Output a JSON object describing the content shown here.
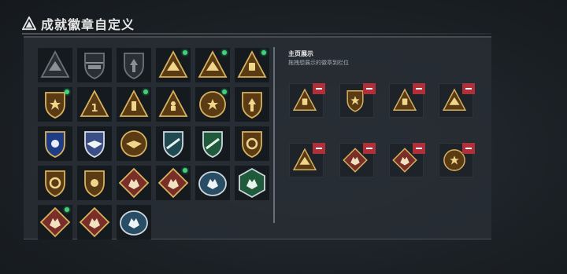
{
  "header": {
    "title": "成就徽章自定义",
    "logo_icon": "triangle-emblem-icon"
  },
  "collection": {
    "badges": [
      {
        "icon": "mountain-triangle-badge-icon",
        "style": "locked",
        "new": false
      },
      {
        "icon": "helicopter-badge-icon",
        "style": "locked",
        "new": false
      },
      {
        "icon": "arrow-shield-badge-icon",
        "style": "locked",
        "new": false
      },
      {
        "icon": "mountain-triangle-badge-icon",
        "style": "gold",
        "new": true
      },
      {
        "icon": "mountain-triangle-badge-icon",
        "style": "gold",
        "new": true
      },
      {
        "icon": "trophy-triangle-badge-icon",
        "style": "gold",
        "new": true
      },
      {
        "icon": "shield-star-badge-icon",
        "style": "gold",
        "new": true
      },
      {
        "icon": "rank-one-triangle-badge-icon",
        "style": "gold",
        "new": false
      },
      {
        "icon": "pillar-triangle-badge-icon",
        "style": "gold",
        "new": true
      },
      {
        "icon": "warrior-triangle-badge-icon",
        "style": "gold",
        "new": false
      },
      {
        "icon": "star-medallion-badge-icon",
        "style": "gold",
        "new": true
      },
      {
        "icon": "arrow-shield-badge-icon",
        "style": "gold",
        "new": false
      },
      {
        "icon": "blue-shield-badge-icon",
        "style": "blue",
        "new": false
      },
      {
        "icon": "eagle-shield-badge-icon",
        "style": "silver",
        "new": false
      },
      {
        "icon": "wings-medallion-badge-icon",
        "style": "gold",
        "new": false
      },
      {
        "icon": "rifle-shield-badge-icon",
        "style": "teal",
        "new": false
      },
      {
        "icon": "rifle-shield-badge-icon",
        "style": "green",
        "new": false
      },
      {
        "icon": "ring-shield-badge-icon",
        "style": "gold",
        "new": false
      },
      {
        "icon": "ring-shield-badge-icon",
        "style": "gold",
        "new": false
      },
      {
        "icon": "winged-shield-badge-icon",
        "style": "gold",
        "new": false
      },
      {
        "icon": "beast-diamond-badge-icon",
        "style": "red",
        "new": false
      },
      {
        "icon": "beast-diamond-badge-icon",
        "style": "red",
        "new": true
      },
      {
        "icon": "wolf-emblem-badge-icon",
        "style": "steel",
        "new": false
      },
      {
        "icon": "dragon-hexagon-badge-icon",
        "style": "green",
        "new": false
      },
      {
        "icon": "beast-diamond-badge-icon",
        "style": "red",
        "new": true
      },
      {
        "icon": "beast-diamond-badge-icon",
        "style": "red",
        "new": false
      },
      {
        "icon": "wolf-emblem-badge-icon",
        "style": "steel",
        "new": false
      }
    ]
  },
  "showcase": {
    "title": "主页展示",
    "subtitle": "拖拽想展示的徽章到栏位",
    "slots": [
      {
        "icon": "trophy-triangle-badge-icon",
        "style": "gold"
      },
      {
        "icon": "shield-star-badge-icon",
        "style": "gold"
      },
      {
        "icon": "trophy-triangle-badge-icon",
        "style": "gold"
      },
      {
        "icon": "mountain-triangle-badge-icon",
        "style": "gold"
      },
      {
        "icon": "mountain-triangle-badge-icon",
        "style": "gold"
      },
      {
        "icon": "beast-diamond-badge-icon",
        "style": "red"
      },
      {
        "icon": "beast-diamond-badge-icon",
        "style": "red"
      },
      {
        "icon": "star-medallion-badge-icon",
        "style": "gold"
      }
    ]
  },
  "colors": {
    "gold": "#c9a24e",
    "gold_dark": "#5a3b14",
    "red_fill": "#7a2e28",
    "new_dot": "#3fd27a",
    "remove": "#b0303a",
    "divider": "#6a7078"
  }
}
